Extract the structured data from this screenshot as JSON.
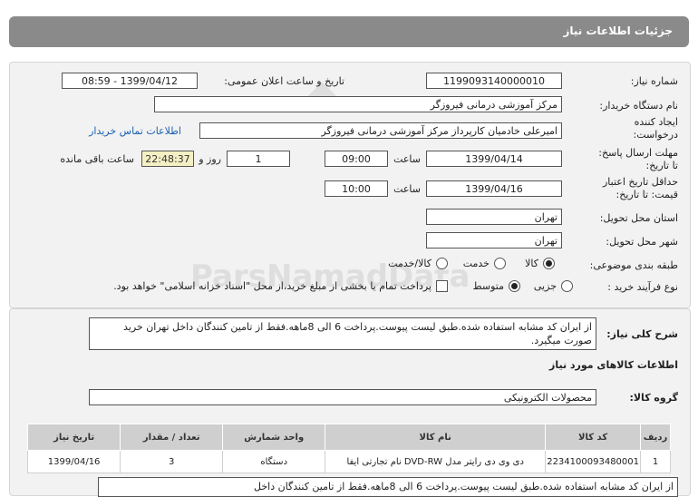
{
  "header": {
    "title": "جزئیات اطلاعات نیاز"
  },
  "watermark": {
    "brand": "ParsNamadData",
    "tagline": "پایگاه اطلاع رسانی مناقصه و مزایده",
    "phone": "۰۲۱-۸۸۳۴۹۶۷۰-۵"
  },
  "form": {
    "need_number_label": "شماره نیاز:",
    "need_number": "1199093140000010",
    "announce_label": "تاریخ و ساعت اعلان عمومی:",
    "announce_value": "1399/04/12 - 08:59",
    "buyer_org_label": "نام دستگاه خریدار:",
    "buyer_org": "مرکز آموزشی درمانی فیروزگر",
    "creator_label_1": "ایجاد کننده",
    "creator_label_2": "درخواست:",
    "creator": "امیرعلی خادمیان کارپرداز مرکز آموزشی درمانی فیروزگر",
    "contact_link": "اطلاعات تماس خریدار",
    "send_deadline_label_1": "مهلت ارسال پاسخ:",
    "send_deadline_label_2": "تا تاریخ:",
    "send_date": "1399/04/14",
    "time_label": "ساعت",
    "send_time": "09:00",
    "days_value": "1",
    "days_label": "روز و",
    "remaining_time": "22:48:37",
    "remaining_label": "ساعت باقی مانده",
    "validity_label_1": "حداقل تاریخ اعتبار",
    "validity_label_2": "قیمت: تا تاریخ:",
    "validity_date": "1399/04/16",
    "validity_time": "10:00",
    "province_label": "استان محل تحویل:",
    "province": "تهران",
    "city_label": "شهر محل تحویل:",
    "city": "تهران",
    "category_label": "طبقه بندی موضوعی:",
    "category_options": [
      "کالا",
      "خدمت",
      "کالا/خدمت"
    ],
    "category_selected": "کالا",
    "process_label": "نوع فرآیند خرید :",
    "process_options": [
      "جزیی",
      "متوسط"
    ],
    "process_selected": "متوسط",
    "payment_note": "پرداخت تمام یا بخشی از مبلغ خرید،از محل \"اسناد خزانه اسلامی\" خواهد بود."
  },
  "details": {
    "desc_label": "شرح کلی نیاز:",
    "description": "از ایران کد مشابه استفاده شده.طبق لیست پیوست.پرداخت 6 الی 8ماهه.فقط از تامین کنندگان داخل تهران خرید صورت میگیرد.",
    "goods_info_title": "اطلاعات کالاهای مورد نیاز",
    "goods_group_label": "گروه کالا:",
    "goods_group": "محصولات الکترونیکی",
    "table": {
      "headers": [
        "ردیف",
        "کد کالا",
        "نام کالا",
        "واحد شمارش",
        "تعداد / مقدار",
        "تاریخ نیاز"
      ],
      "rows": [
        [
          "1",
          "2234100093480001",
          "دی وی دی رایتر مدل DVD-RW نام تجارتی ایفا",
          "دستگاه",
          "3",
          "1399/04/16"
        ]
      ]
    },
    "footer_note": "از ایران کد مشابه استفاده شده.طبق لیست پیوست.پرداخت 6 الی 8ماهه.فقط از تامین کنندگان داخل"
  },
  "colors": {
    "title_bg": "#8a8a8a",
    "panel_bg": "#f2f2f2",
    "link": "#1a5fb4",
    "timer_bg": "#f5f0c4"
  }
}
